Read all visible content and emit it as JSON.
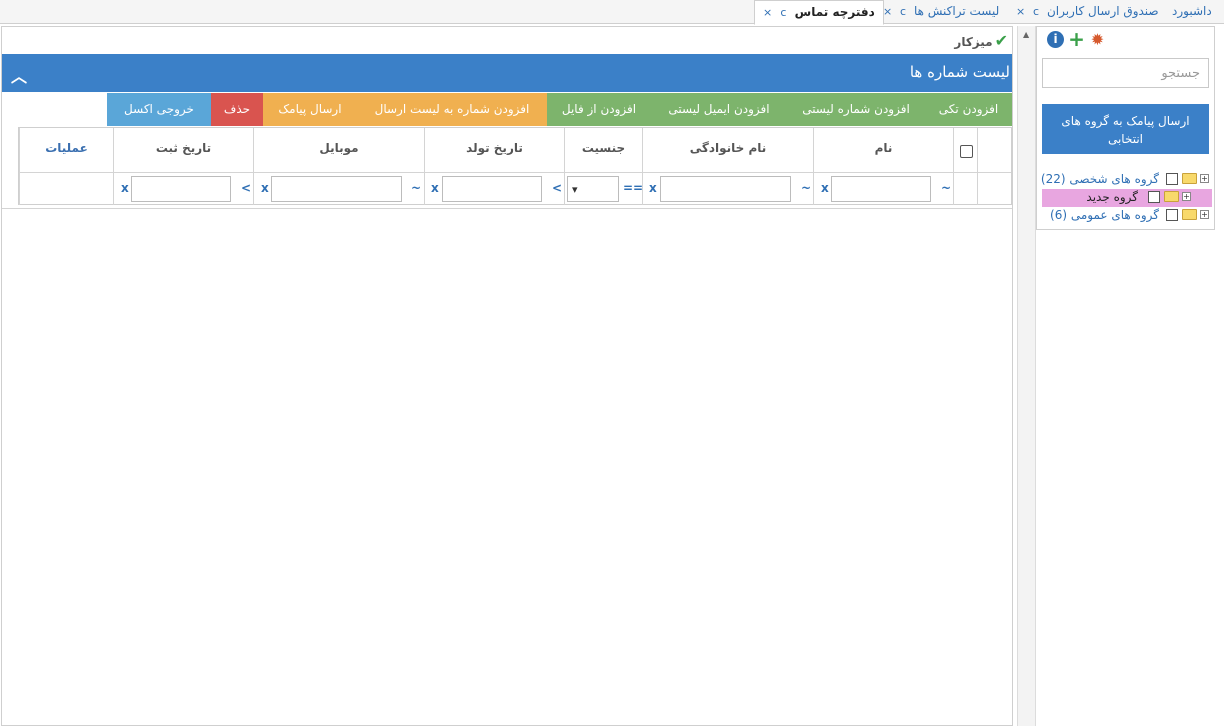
{
  "tabs": [
    {
      "label": "داشبورد",
      "active": false
    },
    {
      "label": "صندوق ارسال کاربران",
      "active": false
    },
    {
      "label": "لیست تراکنش ها",
      "active": false
    },
    {
      "label": "دفترچه تماس",
      "active": true
    }
  ],
  "tab_close_glyph": "×",
  "tab_reload_glyph": "c",
  "sidebar": {
    "search_placeholder": "جستجو",
    "send_group_button": "ارسال پیامک به گروه های انتخابی",
    "tree": [
      {
        "label": "گروه های شخصی (22)",
        "selected": false
      },
      {
        "label": "گروه جدید",
        "selected": true
      },
      {
        "label": "گروه های عمومی (6)",
        "selected": false
      }
    ]
  },
  "breadcrumb": {
    "label": "میزکار"
  },
  "panel": {
    "title": "لیست شماره ها"
  },
  "toolbar": {
    "buttons": [
      {
        "label": "افزودن تکی",
        "color": "#7db46c"
      },
      {
        "label": "افزودن شماره لیستی",
        "color": "#7db46c"
      },
      {
        "label": "افزودن ایمیل لیستی",
        "color": "#7db46c"
      },
      {
        "label": "افزودن از فایل",
        "color": "#7db46c"
      },
      {
        "label": "افزودن شماره به لیست ارسال",
        "color": "#f0b050"
      },
      {
        "label": "ارسال پیامک",
        "color": "#f0b050"
      },
      {
        "label": "حذف",
        "color": "#d9544f"
      },
      {
        "label": "خروجی اکسل",
        "color": "#5aa6d8"
      }
    ]
  },
  "grid": {
    "headers": {
      "name": "نام",
      "family": "نام خانوادگی",
      "gender": "جنسیت",
      "birthdate": "تاریخ تولد",
      "mobile": "موبایل",
      "regdate": "تاریخ ثبت",
      "actions": "عملیات"
    },
    "filter_ops": {
      "name": "~",
      "family": "~",
      "gender": "==",
      "birthdate": "<",
      "mobile": "~",
      "regdate": "<",
      "clear": "x"
    }
  }
}
